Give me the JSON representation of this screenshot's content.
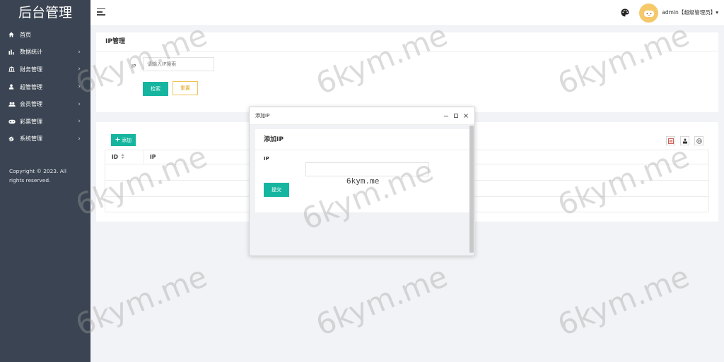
{
  "sidebar": {
    "brand": "后台管理",
    "items": [
      {
        "label": "首页",
        "icon": "home-icon",
        "arrow": ""
      },
      {
        "label": "数据统计",
        "icon": "bar-chart-icon",
        "arrow": "›"
      },
      {
        "label": "财务管理",
        "icon": "bank-icon",
        "arrow": "›"
      },
      {
        "label": "超管管理",
        "icon": "user-icon",
        "arrow": "›"
      },
      {
        "label": "会员管理",
        "icon": "users-icon",
        "arrow": "›"
      },
      {
        "label": "彩票管理",
        "icon": "gamepad-icon",
        "arrow": "›"
      },
      {
        "label": "系统管理",
        "icon": "gear-icon",
        "arrow": "›"
      }
    ],
    "copyright": "Copyright © 2023. All rights reserved."
  },
  "header": {
    "user": "admin【超级管理员】▾"
  },
  "search_card": {
    "title": "IP管理",
    "ip_label": "IP",
    "ip_placeholder": "请输入IP搜索",
    "search_button": "检索",
    "reset_button": "重置"
  },
  "table_card": {
    "add_button": "添加",
    "columns": [
      "ID",
      "IP"
    ]
  },
  "dialog": {
    "window_title": "添加IP",
    "form_title": "添加IP",
    "field_label": "IP",
    "field_value": "",
    "submit_button": "提交"
  },
  "watermark": {
    "text": "6kym.me",
    "small_text": "6kym.me"
  },
  "colors": {
    "sidebar_bg": "#3b4452",
    "accent": "#16b59f",
    "reset_border": "#f2c25a",
    "avatar_bg": "#f5c86a"
  }
}
